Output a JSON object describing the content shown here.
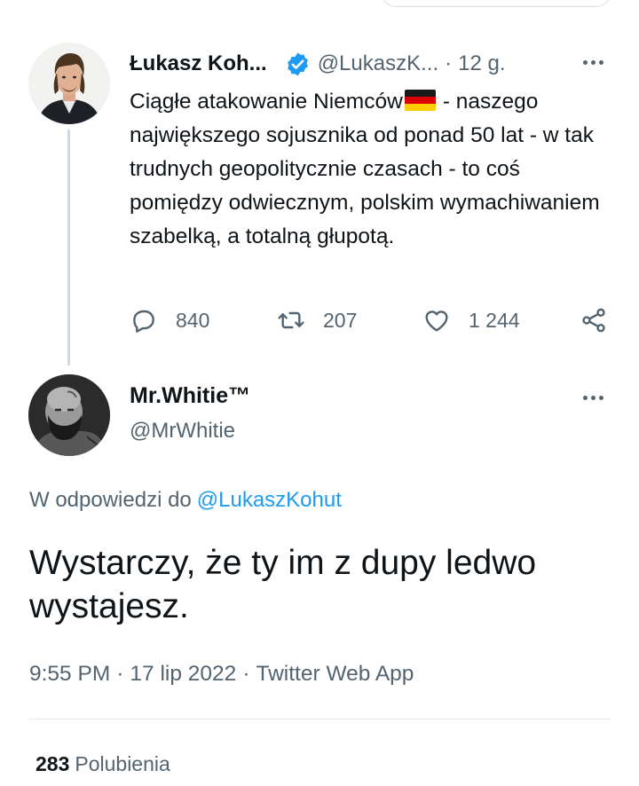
{
  "parent_tweet": {
    "author_name": "Łukasz Koh...",
    "handle": "@LukaszK...",
    "separator": "·",
    "time": "12 g.",
    "text_before_flag": "Ciągłe atakowanie Niemców",
    "flag_icon": "germany-flag-icon",
    "text_after_flag": "- naszego największego sojusznika od ponad 50 lat - w tak trudnych geopolitycznie czasach - to coś pomiędzy odwiecznym, polskim wymachiwaniem szabelką, a totalną głupotą.",
    "stats": {
      "replies": "840",
      "retweets": "207",
      "likes": "1 244"
    }
  },
  "reply_tweet": {
    "author_name": "Mr.Whitie™",
    "handle": "@MrWhitie",
    "replying_to_label": "W odpowiedzi do",
    "replying_to_handle": "@LukaszKohut",
    "text": "Wystarczy, że ty im z dupy ledwo wystajesz.",
    "time": "9:55 PM",
    "date": "17 lip 2022",
    "separator": "·",
    "source": "Twitter Web App",
    "likes_count": "283",
    "likes_label": "Polubienia"
  },
  "colors": {
    "text_primary": "#0f1419",
    "text_secondary": "#536471",
    "accent": "#1d9bf0",
    "verified": "#1d9bf0",
    "thread_line": "#cfd9de",
    "divider": "#e3e8ec"
  },
  "icons": [
    "verified-badge-icon",
    "more-icon",
    "reply-icon",
    "retweet-icon",
    "like-icon",
    "share-icon",
    "germany-flag-icon"
  ]
}
